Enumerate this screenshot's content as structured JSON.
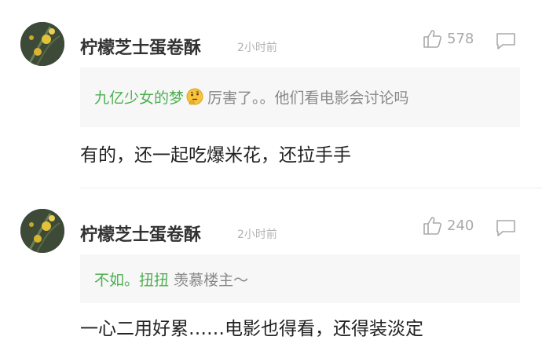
{
  "comments": [
    {
      "username": "柠檬芝士蛋卷酥",
      "time": "2小时前",
      "likes": "578",
      "quote_author": "九亿少女的梦",
      "quote_emoji": "thinking-face-icon",
      "quote_text": "厉害了。。他们看电影会讨论吗",
      "text": "有的，还一起吃爆米花，还拉手手"
    },
    {
      "username": "柠檬芝士蛋卷酥",
      "time": "2小时前",
      "likes": "240",
      "quote_author": "不如。扭扭",
      "quote_text": "羡慕楼主～",
      "text": "一心二用好累……电影也得看，还得装淡定"
    }
  ],
  "colors": {
    "username": "#333333",
    "quote_author": "#4caf50",
    "quote_bg": "#f7f7f7",
    "meta": "#b3b3b3"
  }
}
